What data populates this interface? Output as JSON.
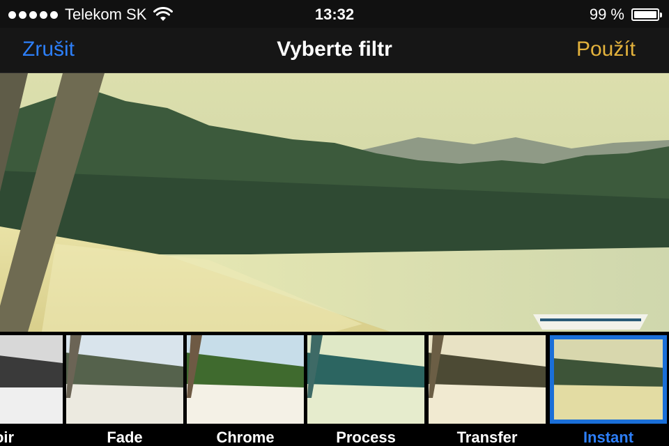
{
  "status_bar": {
    "carrier": "Telekom SK",
    "time": "13:32",
    "battery_percent": "99 %",
    "battery_level": 0.99,
    "icons": [
      "signal-dots-icon",
      "wifi-icon",
      "battery-icon"
    ]
  },
  "nav": {
    "cancel_label": "Zrušit",
    "title": "Vyberte filtr",
    "apply_label": "Použít"
  },
  "colors": {
    "cancel": "#2d7ff9",
    "apply": "#e3b23c",
    "selection": "#1a6fd8"
  },
  "filters": [
    {
      "label": "oir"
    },
    {
      "label": "Fade"
    },
    {
      "label": "Chrome"
    },
    {
      "label": "Process"
    },
    {
      "label": "Transfer"
    },
    {
      "label": "Instant"
    }
  ],
  "selected_filter": "Instant"
}
